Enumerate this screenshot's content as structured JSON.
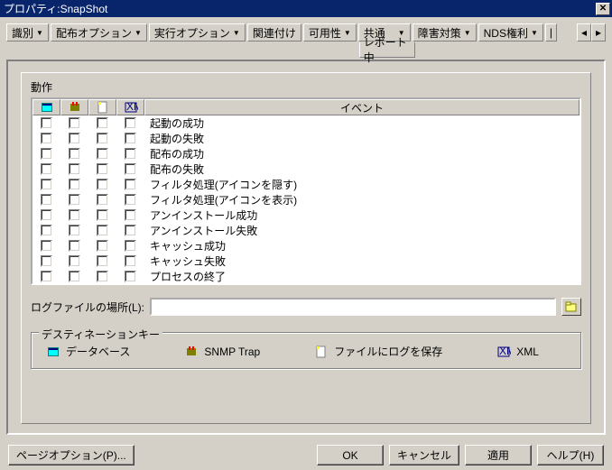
{
  "window": {
    "title": "プロパティ:SnapShot"
  },
  "tabs": {
    "items": [
      "識別",
      "配布オプション",
      "実行オプション",
      "関連付け",
      "可用性",
      "共通",
      "障害対策",
      "NDS権利"
    ],
    "active": 5,
    "active_sub": "レポート中"
  },
  "ops": {
    "label": "動作",
    "event_header": "イベント",
    "events": [
      "起動の成功",
      "起動の失敗",
      "配布の成功",
      "配布の失敗",
      "フィルタ処理(アイコンを隠す)",
      "フィルタ処理(アイコンを表示)",
      "アンインストール成功",
      "アンインストール失敗",
      "キャッシュ成功",
      "キャッシュ失敗",
      "プロセスの終了"
    ]
  },
  "log": {
    "label": "ログファイルの場所(L):",
    "value": ""
  },
  "dest": {
    "legend": "デスティネーションキー",
    "db": "データベース",
    "snmp": "SNMP Trap",
    "file": "ファイルにログを保存",
    "xml": "XML"
  },
  "buttons": {
    "page": "ページオプション(P)...",
    "ok": "OK",
    "cancel": "キャンセル",
    "apply": "適用",
    "help": "ヘルプ(H)"
  }
}
